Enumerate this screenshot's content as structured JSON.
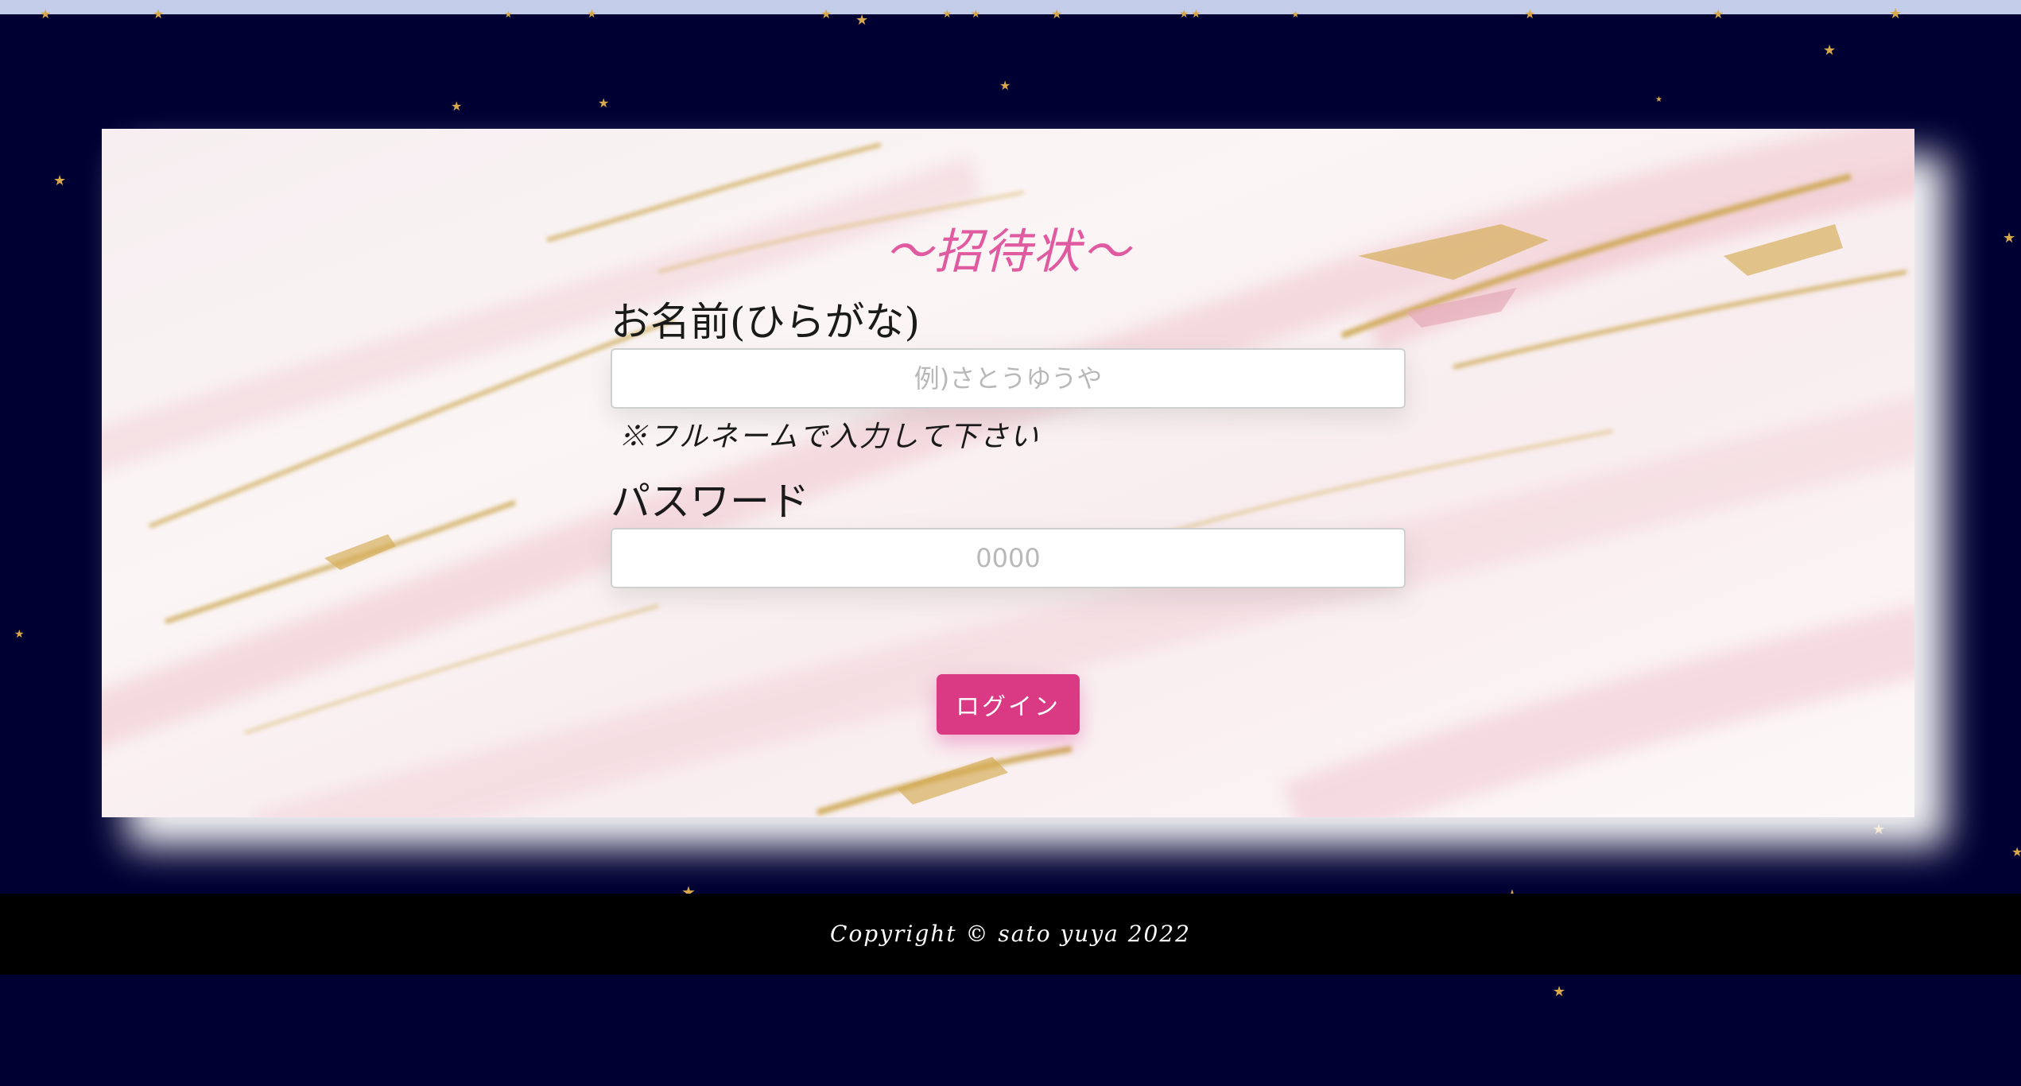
{
  "colors": {
    "background": "#000033",
    "top_strip": "#c3cdea",
    "star": "#d9a84a",
    "title": "#e05aa0",
    "button": "#d93a83",
    "footer": "#000000"
  },
  "card": {
    "title": "～招待状～"
  },
  "form": {
    "name_label": "お名前(ひらがな)",
    "name_placeholder": "例)さとうゆうや",
    "name_note": "※フルネームで入力して下さい",
    "password_label": "パスワード",
    "password_placeholder": "0000",
    "login_label": "ログイン"
  },
  "footer": {
    "copyright": "Copyright © sato yuya 2022"
  },
  "decor": {
    "star_icon": "star-icon"
  }
}
